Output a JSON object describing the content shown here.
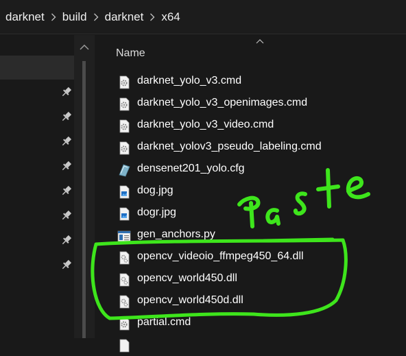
{
  "breadcrumb": {
    "items": [
      "darknet",
      "build",
      "darknet",
      "x64"
    ]
  },
  "columns": {
    "name_label": "Name"
  },
  "files": [
    {
      "name": "darknet_yolo_v3.cmd",
      "icon": "gear-file-icon"
    },
    {
      "name": "darknet_yolo_v3_openimages.cmd",
      "icon": "gear-file-icon"
    },
    {
      "name": "darknet_yolo_v3_video.cmd",
      "icon": "gear-file-icon"
    },
    {
      "name": "darknet_yolov3_pseudo_labeling.cmd",
      "icon": "gear-file-icon"
    },
    {
      "name": "densenet201_yolo.cfg",
      "icon": "cfg-file-icon"
    },
    {
      "name": "dog.jpg",
      "icon": "image-file-icon"
    },
    {
      "name": "dogr.jpg",
      "icon": "image-file-icon"
    },
    {
      "name": "gen_anchors.py",
      "icon": "python-file-icon"
    },
    {
      "name": "opencv_videoio_ffmpeg450_64.dll",
      "icon": "dll-file-icon"
    },
    {
      "name": "opencv_world450.dll",
      "icon": "dll-file-icon"
    },
    {
      "name": "opencv_world450d.dll",
      "icon": "dll-file-icon"
    },
    {
      "name": "partial.cmd",
      "icon": "gear-file-icon"
    }
  ],
  "annotation": {
    "text": "Paste",
    "color": "#3ee51c"
  },
  "colors": {
    "background": "#191919",
    "text": "#ffffff",
    "annotation": "#3ee51c"
  }
}
